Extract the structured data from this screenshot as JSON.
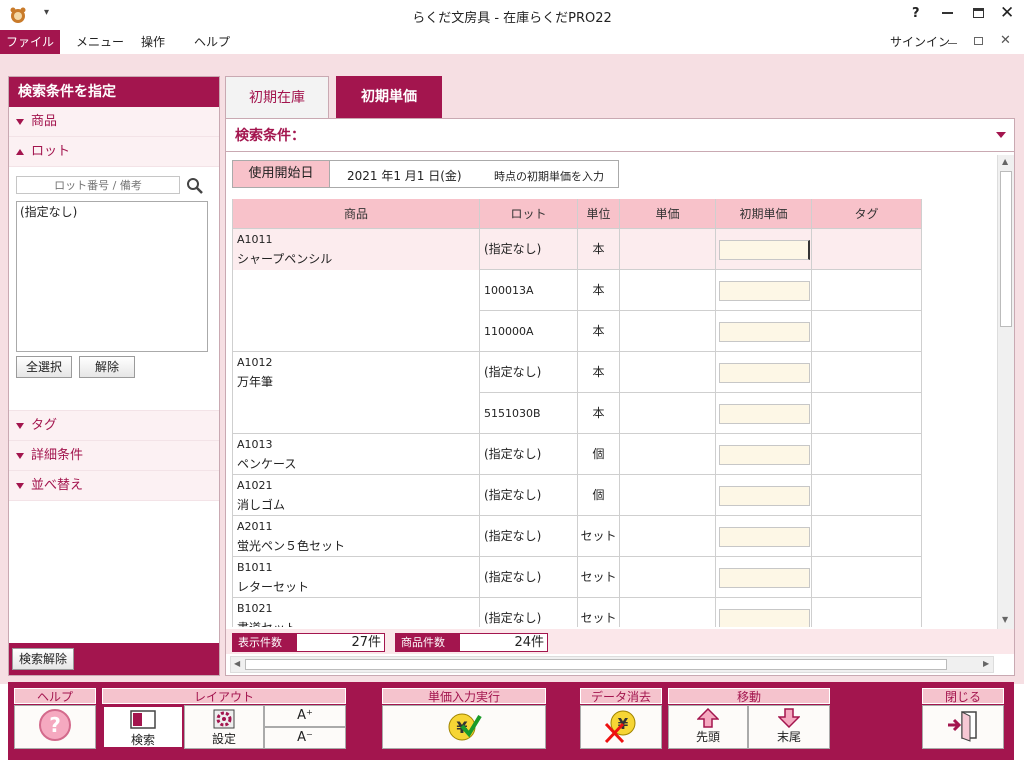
{
  "window": {
    "title": "らくだ文房具 - 在庫らくだPRO22",
    "help": "?",
    "signin": "サインイン"
  },
  "menu": {
    "file": "ファイル",
    "items": [
      "メニュー",
      "操作",
      "ヘルプ"
    ]
  },
  "left": {
    "header": "検索条件を指定",
    "sections": {
      "product": "商品",
      "lot": "ロット",
      "tag": "タグ",
      "detail": "詳細条件",
      "sort": "並べ替え"
    },
    "lot_search_placeholder": "ロット番号 / 備考",
    "lot_list": [
      "(指定なし)"
    ],
    "select_all": "全選択",
    "clear": "解除",
    "reset_search": "検索解除"
  },
  "tabs": {
    "initial_stock": "初期在庫",
    "initial_price": "初期単価"
  },
  "search_bar": {
    "label": "検索条件："
  },
  "start_date": {
    "label": "使用開始日",
    "value": "2021 年1 月1 日(金)",
    "suffix": "時点の初期単価を入力"
  },
  "table": {
    "headers": [
      "商品",
      "ロット",
      "単位",
      "単価",
      "初期単価",
      "タグ"
    ],
    "rows": [
      {
        "code": "A1011",
        "name": "シャープペンシル",
        "lots": [
          {
            "lot": "(指定なし)",
            "unit": "本"
          },
          {
            "lot": "100013A",
            "unit": "本"
          },
          {
            "lot": "110000A",
            "unit": "本"
          }
        ]
      },
      {
        "code": "A1012",
        "name": "万年筆",
        "lots": [
          {
            "lot": "(指定なし)",
            "unit": "本"
          },
          {
            "lot": "5151030B",
            "unit": "本"
          }
        ]
      },
      {
        "code": "A1013",
        "name": "ペンケース",
        "lots": [
          {
            "lot": "(指定なし)",
            "unit": "個"
          }
        ]
      },
      {
        "code": "A1021",
        "name": "消しゴム",
        "lots": [
          {
            "lot": "(指定なし)",
            "unit": "個"
          }
        ]
      },
      {
        "code": "A2011",
        "name": "蛍光ペン５色セット",
        "lots": [
          {
            "lot": "(指定なし)",
            "unit": "セット"
          }
        ]
      },
      {
        "code": "B1011",
        "name": "レターセット",
        "lots": [
          {
            "lot": "(指定なし)",
            "unit": "セット"
          }
        ]
      },
      {
        "code": "B1021",
        "name": "書道セット",
        "lots": [
          {
            "lot": "(指定なし)",
            "unit": "セット"
          }
        ]
      }
    ]
  },
  "counts": {
    "display_label": "表示件数",
    "display_value": "27件",
    "product_label": "商品件数",
    "product_value": "24件"
  },
  "toolbar": {
    "help": {
      "group": "ヘルプ",
      "icon": "?"
    },
    "layout": {
      "group": "レイアウト",
      "search": "検索",
      "settings": "設定",
      "font_up": "A⁺",
      "font_down": "A⁻"
    },
    "execute": {
      "group": "単価入力実行"
    },
    "erase": {
      "group": "データ消去"
    },
    "move": {
      "group": "移動",
      "first": "先頭",
      "last": "末尾"
    },
    "close": {
      "group": "閉じる"
    }
  },
  "colors": {
    "accent": "#a3154e",
    "header_pink": "#f8c2ca",
    "bg_pink": "#f6dfe3",
    "input_cream": "#fdf7e6"
  }
}
